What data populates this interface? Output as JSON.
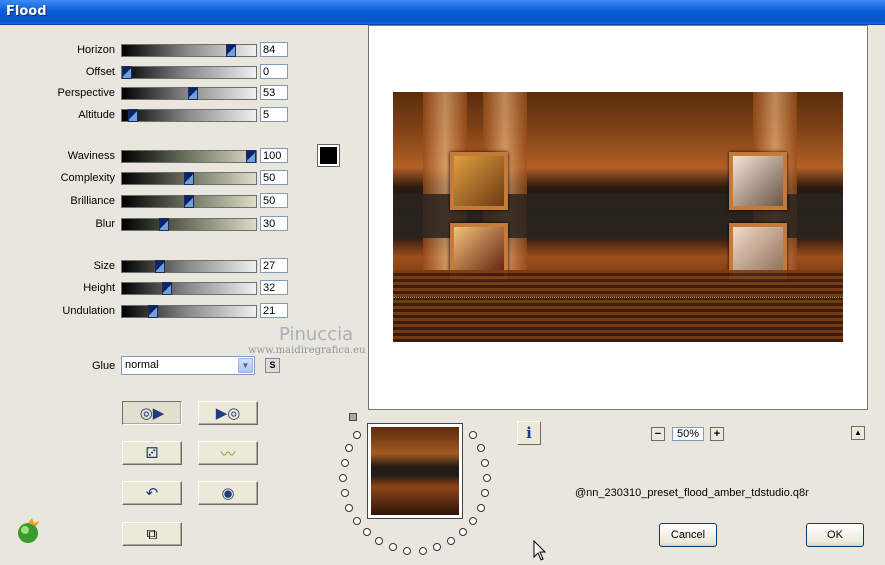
{
  "window": {
    "title": "Flood"
  },
  "sliders_group1": [
    {
      "label": "Horizon",
      "value": "84",
      "fraction": 0.84
    },
    {
      "label": "Offset",
      "value": "0",
      "fraction": 0.0
    },
    {
      "label": "Perspective",
      "value": "53",
      "fraction": 0.53
    },
    {
      "label": "Altitude",
      "value": "5",
      "fraction": 0.05
    }
  ],
  "sliders_group2": [
    {
      "label": "Waviness",
      "value": "100",
      "fraction": 1.0
    },
    {
      "label": "Complexity",
      "value": "50",
      "fraction": 0.5
    },
    {
      "label": "Brilliance",
      "value": "50",
      "fraction": 0.5
    },
    {
      "label": "Blur",
      "value": "30",
      "fraction": 0.3
    }
  ],
  "sliders_group3": [
    {
      "label": "Size",
      "value": "27",
      "fraction": 0.27
    },
    {
      "label": "Height",
      "value": "32",
      "fraction": 0.32
    },
    {
      "label": "Undulation",
      "value": "21",
      "fraction": 0.21
    }
  ],
  "color_swatch": "#000000",
  "glue": {
    "label": "Glue",
    "value": "normal",
    "s_button": "S"
  },
  "watermark": {
    "name": "Pinuccia",
    "url": "www.maidiregrafica.eu"
  },
  "zoom": {
    "minus": "−",
    "value": "50%",
    "plus": "+"
  },
  "preset_file": "@nn_230310_preset_flood_amber_tdstudio.q8r",
  "buttons": {
    "cancel": "Cancel",
    "ok": "OK"
  },
  "icons": {
    "tool1": "apply-filter-icon",
    "tool2": "reset-filter-icon",
    "tool3": "random-dice-icon",
    "tool4": "wave-icon",
    "tool5": "undo-icon",
    "tool6": "reset-circle-icon",
    "tool7": "copy-icon",
    "info": "info-icon",
    "logo": "plugin-logo-icon"
  }
}
